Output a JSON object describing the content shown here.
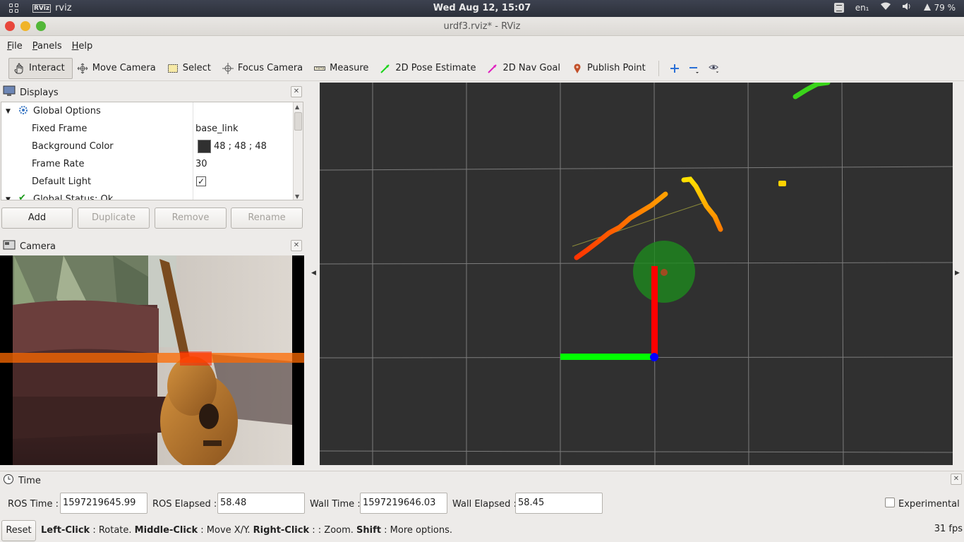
{
  "system_bar": {
    "app_name": "rviz",
    "app_icon_text": "RViz",
    "clock": "Wed Aug 12, 15:07",
    "keyboard_layout": "en₁",
    "battery": "79 %"
  },
  "window": {
    "title": "urdf3.rviz* - RViz"
  },
  "menu": {
    "file": "File",
    "panels": "Panels",
    "help": "Help"
  },
  "toolbar": {
    "interact": "Interact",
    "move_camera": "Move Camera",
    "select": "Select",
    "focus_camera": "Focus Camera",
    "measure": "Measure",
    "pose_estimate": "2D Pose Estimate",
    "nav_goal": "2D Nav Goal",
    "publish_point": "Publish Point"
  },
  "displays_panel": {
    "title": "Displays",
    "global_options": "Global Options",
    "fixed_frame_label": "Fixed Frame",
    "fixed_frame_value": "base_link",
    "bg_color_label": "Background Color",
    "bg_color_value": "48 ; 48 ; 48",
    "bg_color_hex": "#303030",
    "frame_rate_label": "Frame Rate",
    "frame_rate_value": "30",
    "default_light_label": "Default Light",
    "default_light_checked": "✓",
    "global_status": "Global Status: Ok",
    "buttons": {
      "add": "Add",
      "duplicate": "Duplicate",
      "remove": "Remove",
      "rename": "Rename"
    }
  },
  "camera_panel": {
    "title": "Camera"
  },
  "time_panel": {
    "title": "Time",
    "ros_time_label": "ROS Time :",
    "ros_time": "1597219645.99",
    "ros_elapsed_label": "ROS Elapsed :",
    "ros_elapsed": "58.48",
    "wall_time_label": "Wall Time :",
    "wall_time": "1597219646.03",
    "wall_elapsed_label": "Wall Elapsed :",
    "wall_elapsed": "58.45",
    "experimental": "Experimental",
    "reset": "Reset",
    "fps": "31 fps"
  },
  "status_hint": {
    "left_click": "Left-Click",
    "rotate": ": Rotate.",
    "middle_click": "Middle-Click",
    "move": ": Move X/Y.",
    "right_click": "Right-Click",
    "zoom": ": : Zoom.",
    "shift": "Shift",
    "more": ": More options."
  },
  "colors": {
    "x_axis": "#00ff00",
    "y_axis": "#ff0000",
    "origin": "#0000ff",
    "laser_near": "#ff3300",
    "laser_far": "#ffee00",
    "goal_circle": "#1e8a1e"
  }
}
